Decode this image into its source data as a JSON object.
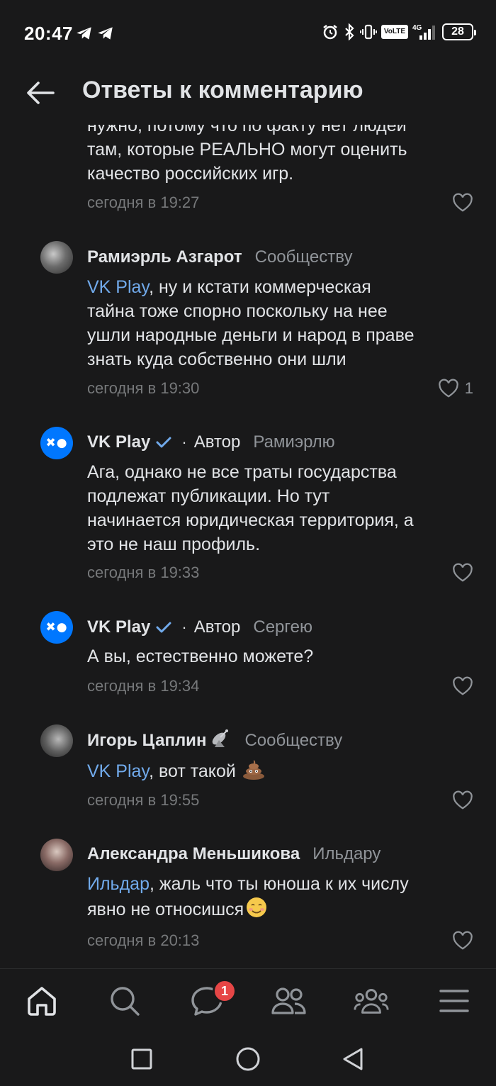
{
  "status_bar": {
    "time": "20:47",
    "network_label": "VoLTE",
    "network_type": "4G",
    "battery": "28"
  },
  "header": {
    "title": "Ответы к комментарию"
  },
  "partial_comment": {
    "lines": [
      "нужно, потому что по факту нет людей",
      "там, которые РЕАЛЬНО могут оценить",
      "качество российских игр."
    ],
    "time": "сегодня в 19:27"
  },
  "comments": [
    {
      "author": "Рамиэрль Азгарот",
      "reply_to": "Сообществу",
      "mention": "VK Play",
      "lines": [
        ",  ну и кстати коммерческая",
        "тайна тоже спорно поскольку на нее",
        "ушли  народные деньги и народ в праве",
        "знать куда собственно они шли"
      ],
      "time": "сегодня в 19:30",
      "likes": "1"
    },
    {
      "author": "VK Play",
      "role": "Автор",
      "reply_to": "Рамиэрлю",
      "lines": [
        "Ага, однако не все траты государства",
        "подлежат публикации. Но тут",
        "начинается юридическая территория, а",
        "это не наш профиль."
      ],
      "time": "сегодня в 19:33"
    },
    {
      "author": "VK Play",
      "role": "Автор",
      "reply_to": "Сергею",
      "lines": [
        "А вы, естественно можете?"
      ],
      "time": "сегодня в 19:34"
    },
    {
      "author": "Игорь Цаплин",
      "reply_to": "Сообществу",
      "mention": "VK Play",
      "text_after": ", вот такой ",
      "time": "сегодня в 19:55"
    },
    {
      "author": "Александра Меньшикова",
      "reply_to": "Ильдару",
      "mention": "Ильдар",
      "line1_after": ", жаль что ты юноша к их числу",
      "line2": "явно не относишся",
      "time": "сегодня в 20:13"
    }
  ],
  "tabbar": {
    "items": [
      "home-icon",
      "search-icon",
      "messages-icon",
      "friends-icon",
      "communities-icon",
      "menu-icon"
    ],
    "messages_badge": "1"
  },
  "colors": {
    "background": "#19191a",
    "text": "#e1e3e6",
    "secondary": "#76787a",
    "accent": "#71aaeb",
    "vk_blue": "#0077ff",
    "badge": "#e64646"
  }
}
